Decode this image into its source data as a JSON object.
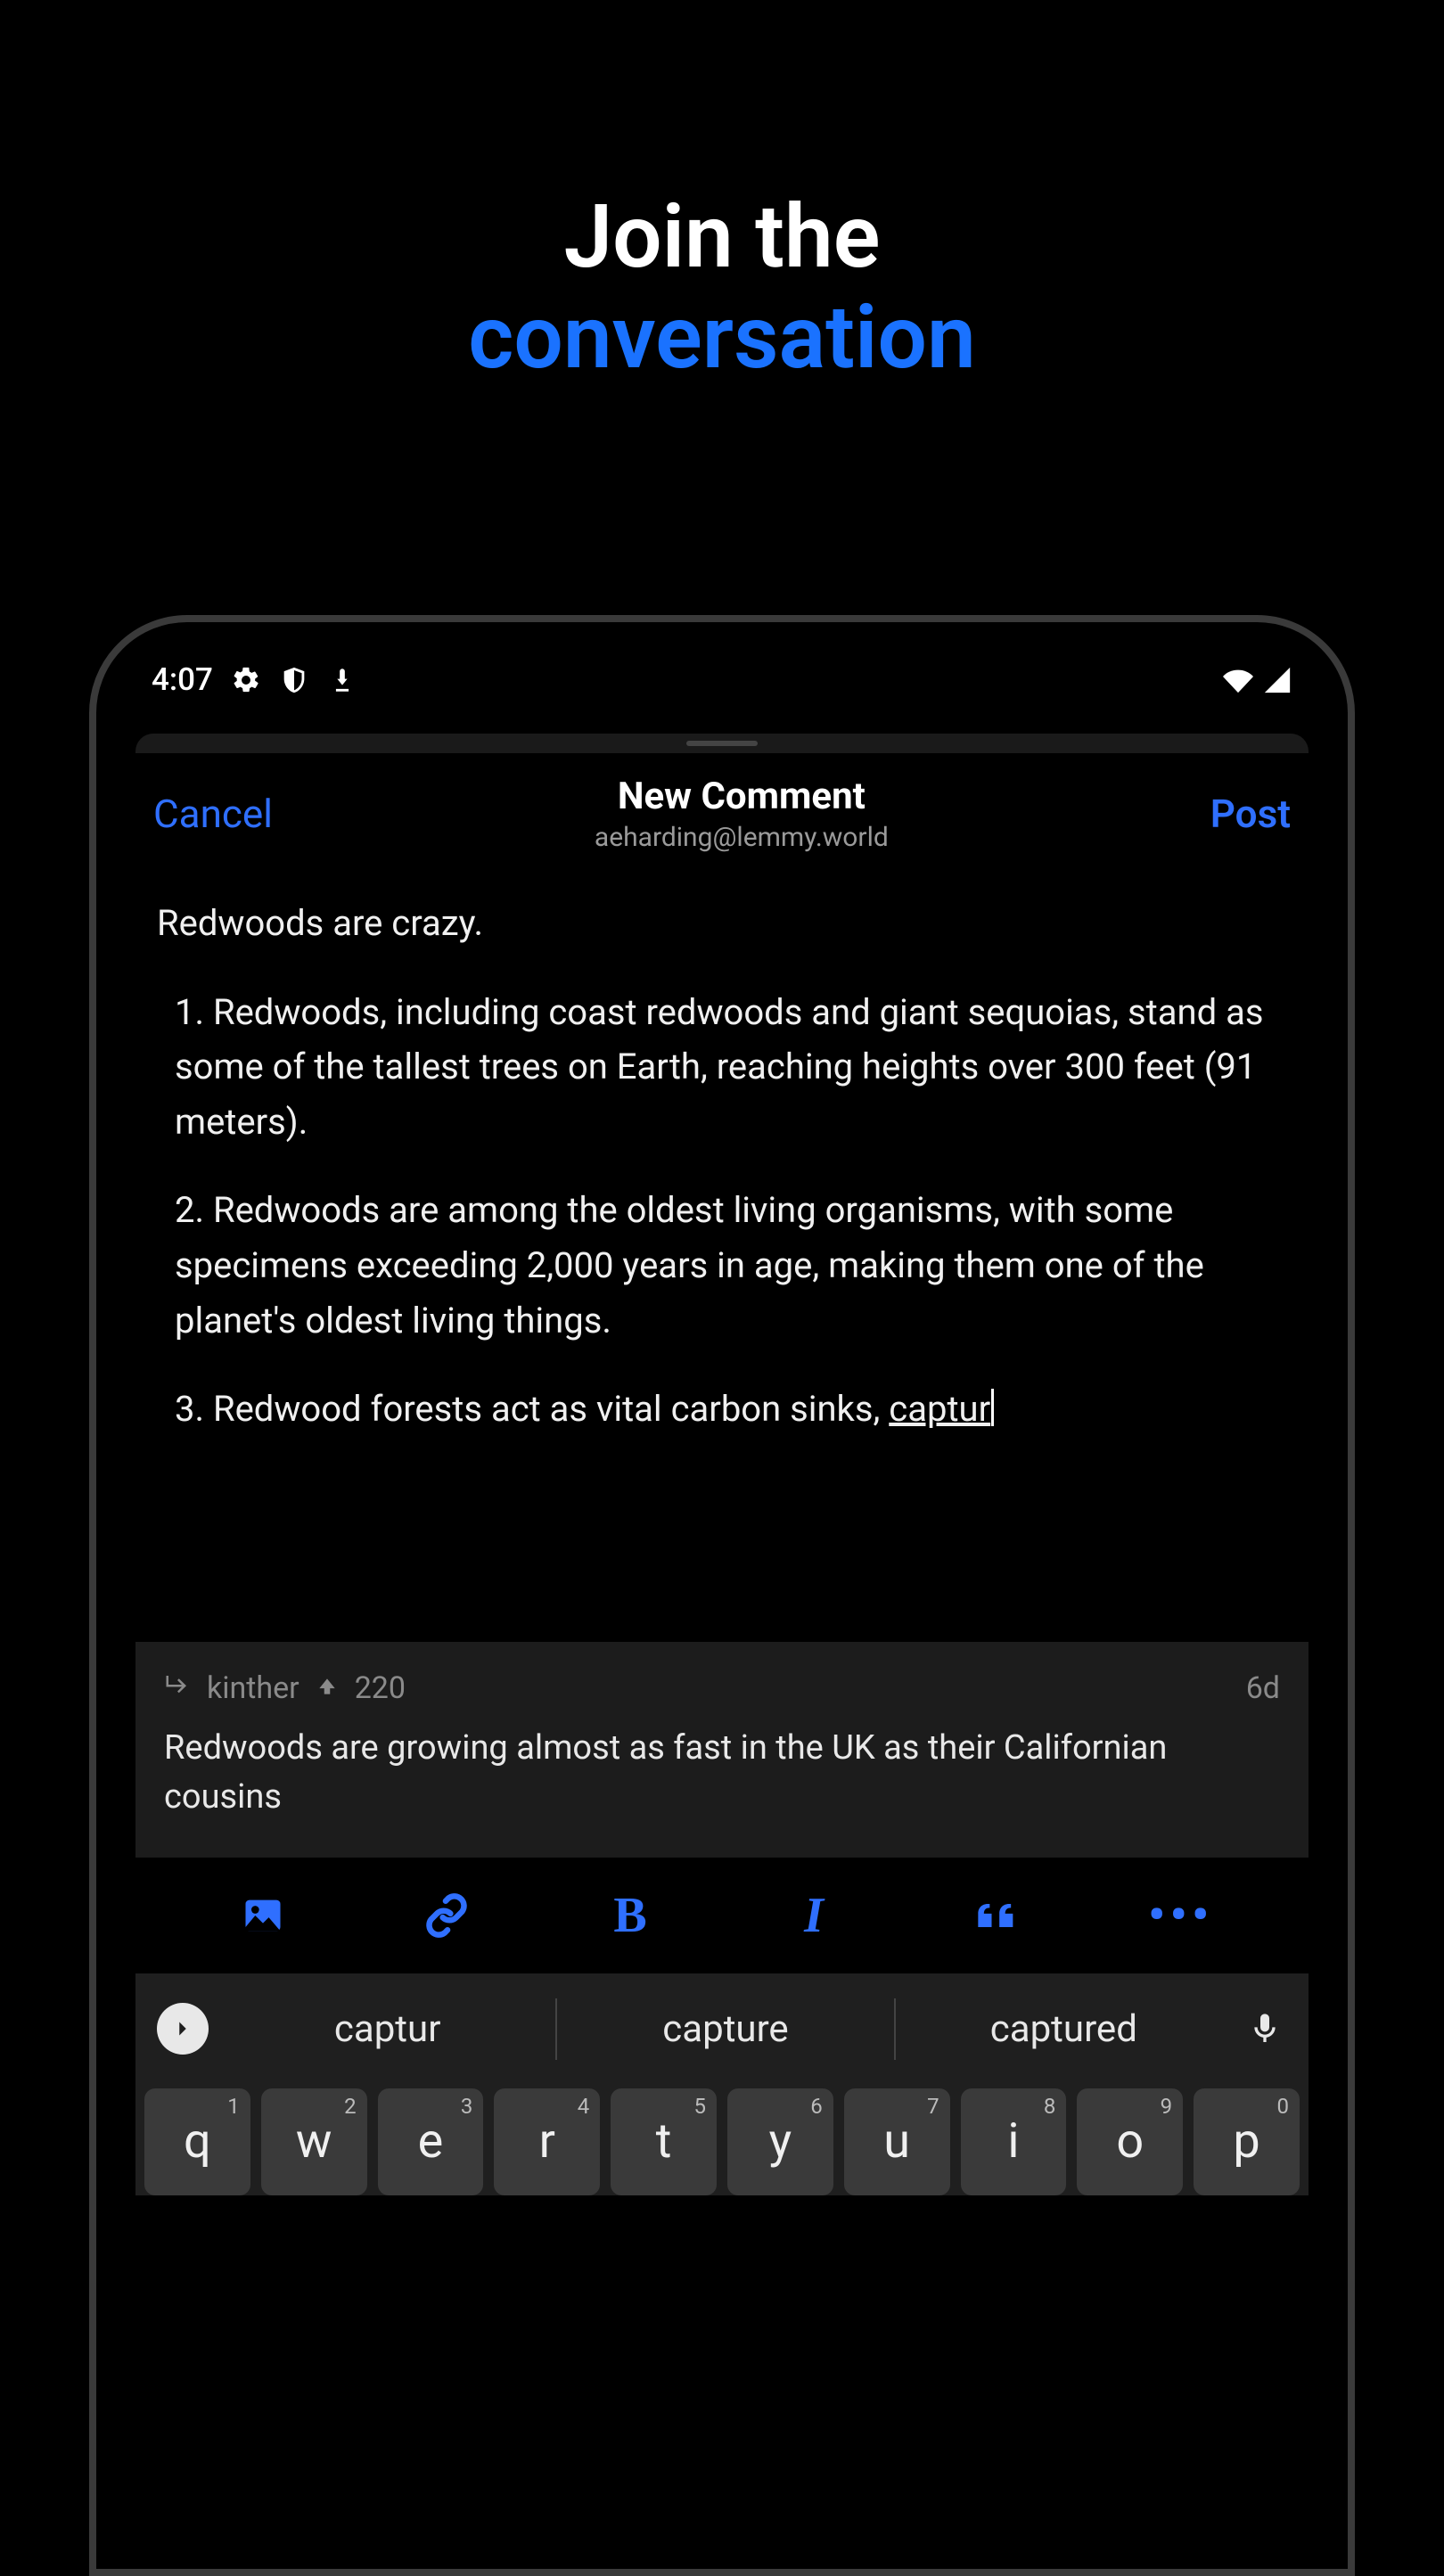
{
  "promo": {
    "line1": "Join the",
    "line2": "conversation"
  },
  "status_bar": {
    "time": "4:07"
  },
  "nav": {
    "cancel": "Cancel",
    "title": "New Comment",
    "subtitle": "aeharding@lemmy.world",
    "post": "Post"
  },
  "comment": {
    "intro": "Redwoods are crazy.",
    "points": [
      "1. Redwoods, including coast redwoods and giant sequoias, stand as some of the tallest trees on Earth, reaching heights over 300 feet (91 meters).",
      "2. Redwoods are among the oldest living organisms, with some specimens exceeding 2,000 years in age, making them one of the planet's oldest living things.",
      "3. Redwood forests act as vital carbon sinks, "
    ],
    "trailing_underlined": "captur"
  },
  "reply_context": {
    "author": "kinther",
    "score": "220",
    "age": "6d",
    "text": "Redwoods are growing almost as fast in the UK as their Californian cousins"
  },
  "toolbar": {
    "icons": [
      "image",
      "link",
      "bold",
      "italic",
      "quote",
      "more"
    ]
  },
  "keyboard": {
    "suggestions": [
      "captur",
      "capture",
      "captured"
    ],
    "row1_keys": [
      "q",
      "w",
      "e",
      "r",
      "t",
      "y",
      "u",
      "i",
      "o",
      "p"
    ],
    "row1_sups": [
      "1",
      "2",
      "3",
      "4",
      "5",
      "6",
      "7",
      "8",
      "9",
      "0"
    ]
  },
  "colors": {
    "accent": "#2f6fff"
  }
}
